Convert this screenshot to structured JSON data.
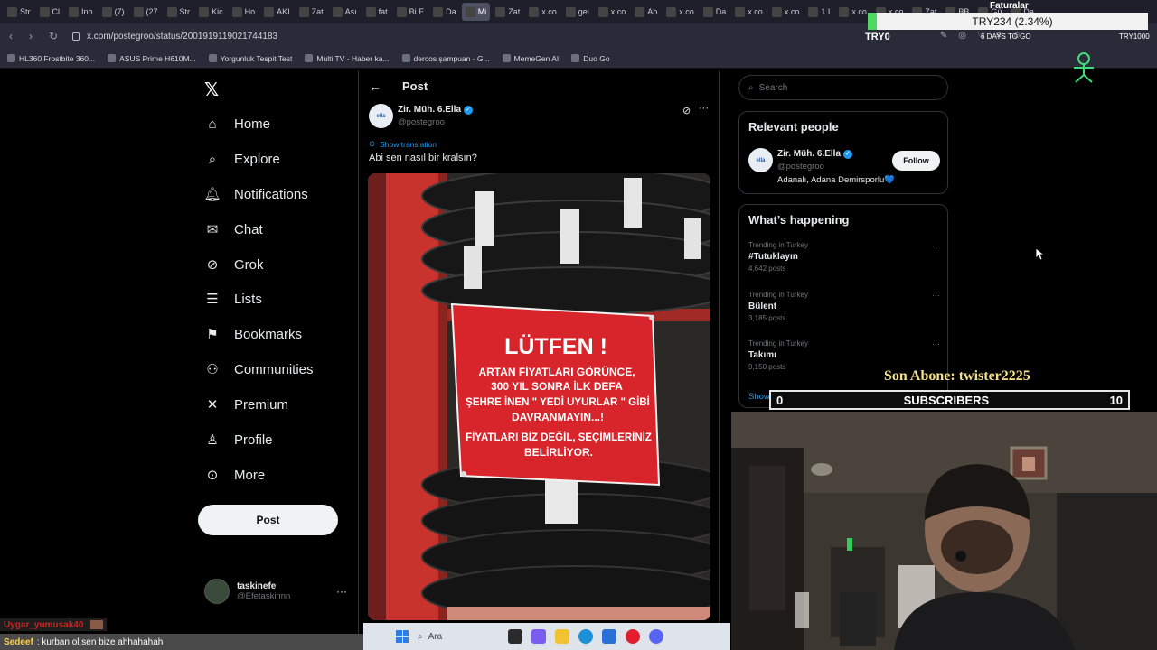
{
  "browser": {
    "tabs": [
      "Str",
      "Cl",
      "Inb",
      "(7)",
      "(27",
      "Str",
      "Kic",
      "Ho",
      "AKI",
      "Zat",
      "Ası",
      "fat",
      "Bi E",
      "Da",
      "Mi",
      "Zat",
      "x.co",
      "gei",
      "x.co",
      "Ab",
      "x.co",
      "Da",
      "x.co",
      "x.co",
      "1 I",
      "x.co",
      "x.co",
      "Zat",
      "BB",
      "Gü",
      "Da"
    ],
    "active_tab": "Mi",
    "url": "x.com/postegroo/status/2001919119021744183",
    "bookmarks": [
      "HL360 Frostbite 360...",
      "ASUS Prime H610M...",
      "Yorgunluk Tespit Test",
      "Multi TV - Haber ka...",
      "dercos şampuan - G...",
      "MemeGen AI",
      "Duo Go"
    ]
  },
  "stream_overlay": {
    "faturalar": "Faturalar",
    "ticker": "TRY234 (2.34%)",
    "goal_start": "TRY0",
    "days_to_go": "6 DAYS TO GO",
    "goal_end": "TRY1000",
    "last_sub_label": "Son Abone: twister2225",
    "subs_current": "0",
    "subs_title": "SUBSCRIBERS",
    "subs_goal": "10"
  },
  "sidebar": {
    "items": [
      {
        "label": "Home",
        "icon": "home-icon"
      },
      {
        "label": "Explore",
        "icon": "search-icon"
      },
      {
        "label": "Notifications",
        "icon": "bell-icon"
      },
      {
        "label": "Chat",
        "icon": "mail-icon"
      },
      {
        "label": "Grok",
        "icon": "grok-icon"
      },
      {
        "label": "Lists",
        "icon": "list-icon"
      },
      {
        "label": "Bookmarks",
        "icon": "bookmark-icon"
      },
      {
        "label": "Communities",
        "icon": "people-icon"
      },
      {
        "label": "Premium",
        "icon": "x-icon"
      },
      {
        "label": "Profile",
        "icon": "person-icon"
      },
      {
        "label": "More",
        "icon": "more-circle-icon"
      }
    ],
    "post_button": "Post",
    "account": {
      "name": "taskinefe",
      "handle": "@Efetaskinnn"
    }
  },
  "post": {
    "heading": "Post",
    "author_name": "Zir. Müh. 6.Ella",
    "author_handle": "@postegroo",
    "avatar_text": "ella",
    "show_translation": "Show translation",
    "text": "Abi sen nasıl bir kralsın?",
    "sign": {
      "title": "LÜTFEN !",
      "lines": [
        "ARTAN FİYATLARI GÖRÜNCE,",
        "300 YIL SONRA İLK DEFA",
        "ŞEHRE İNEN \" YEDİ UYURLAR \" GİBİ",
        "DAVRANMAYIN...!",
        "FİYATLARI BİZ DEĞİL, SEÇİMLERİNİZ",
        "BELİRLİYOR."
      ]
    }
  },
  "right": {
    "search_placeholder": "Search",
    "relevant_people": {
      "title": "Relevant people",
      "name": "Zir. Müh. 6.Ella",
      "handle": "@postegroo",
      "bio": "Adanalı, Adana Demirsporlu💙",
      "follow": "Follow"
    },
    "whats_happening": {
      "title": "What’s happening",
      "trends": [
        {
          "context": "Trending in Turkey",
          "name": "#Tutuklayın",
          "posts": "4,642 posts"
        },
        {
          "context": "Trending in Turkey",
          "name": "Bülent",
          "posts": "3,185 posts"
        },
        {
          "context": "Trending in Turkey",
          "name": "Takımı",
          "posts": "9,150 posts"
        }
      ],
      "show_more": "Show more"
    }
  },
  "taskbar": {
    "search": "Ara"
  },
  "chat": [
    {
      "user": "Uygar_yumusak40",
      "message": ""
    },
    {
      "user": "Sedeef",
      "message": ": kurban ol sen bize ahhahahah"
    }
  ],
  "colors": {
    "accent": "#1d9bf0",
    "sign_red": "#d8242b",
    "bg": "#000000"
  }
}
